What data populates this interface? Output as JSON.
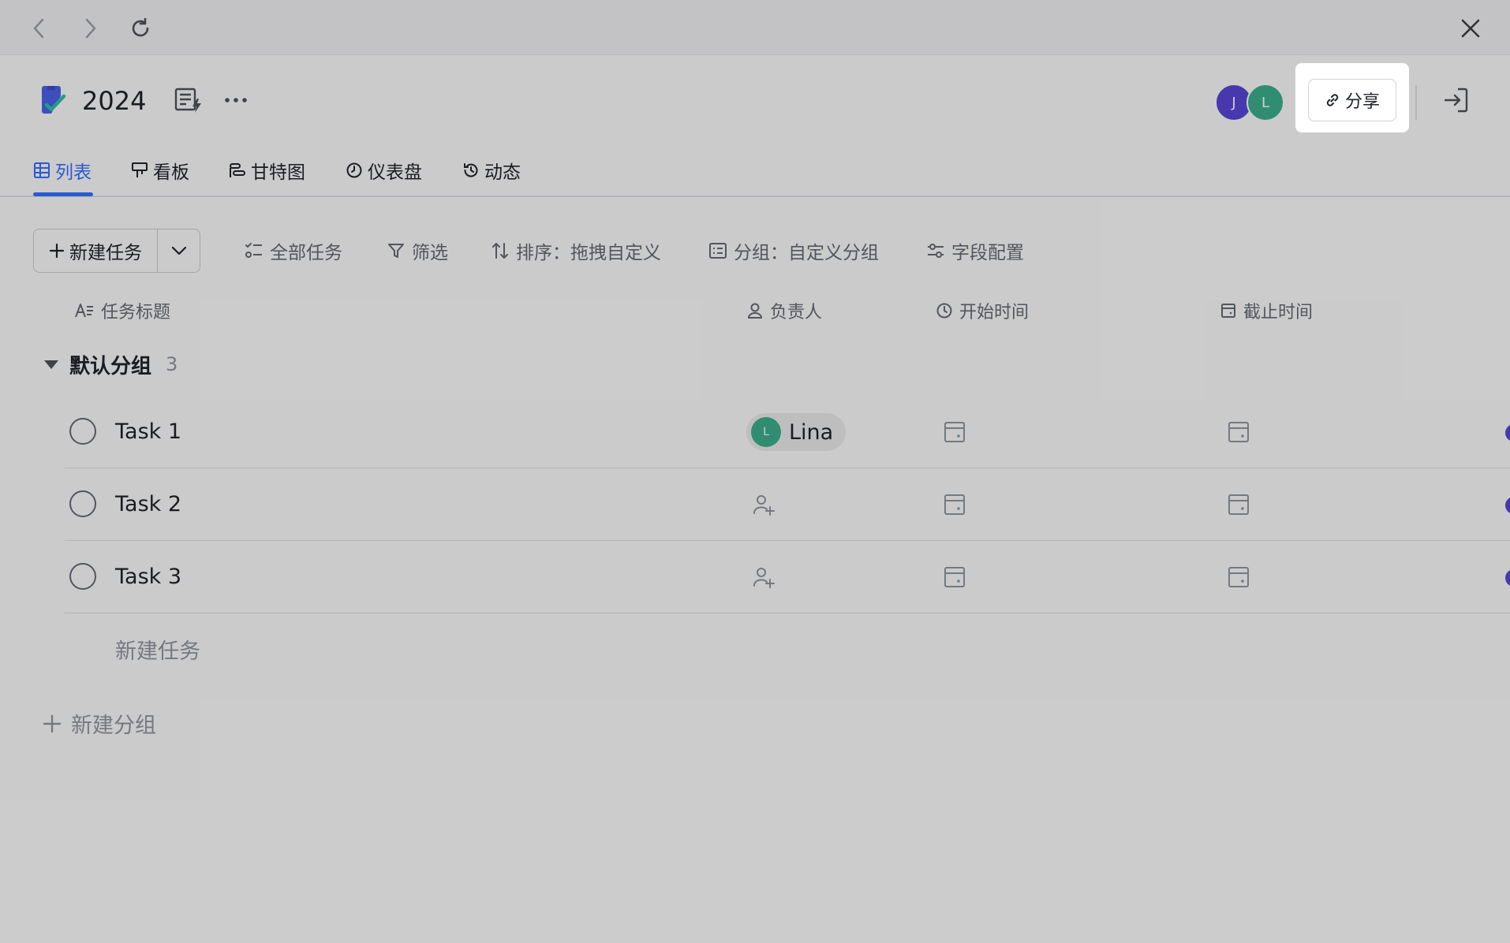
{
  "window": {
    "back_icon": "chevron-left-icon",
    "forward_icon": "chevron-right-icon",
    "reload_icon": "reload-icon",
    "close_icon": "close-icon"
  },
  "header": {
    "project_title": "2024",
    "members": [
      {
        "initial": "J",
        "color": "#5b45d6"
      },
      {
        "initial": "L",
        "color": "#3cae8c"
      }
    ],
    "share_label": "分享"
  },
  "tabs": [
    {
      "label": "列表",
      "icon": "table-icon",
      "active": true
    },
    {
      "label": "看板",
      "icon": "kanban-icon",
      "active": false
    },
    {
      "label": "甘特图",
      "icon": "gantt-icon",
      "active": false
    },
    {
      "label": "仪表盘",
      "icon": "dashboard-icon",
      "active": false
    },
    {
      "label": "动态",
      "icon": "history-icon",
      "active": false
    }
  ],
  "toolbar": {
    "new_task_label": "新建任务",
    "all_tasks_label": "全部任务",
    "filter_label": "筛选",
    "sort_label": "排序：拖拽自定义",
    "group_label": "分组：自定义分组",
    "fields_label": "字段配置"
  },
  "columns": {
    "title": "任务标题",
    "assignee": "负责人",
    "start": "开始时间",
    "due": "截止时间"
  },
  "group": {
    "name": "默认分组",
    "count": "3"
  },
  "tasks": [
    {
      "title": "Task 1",
      "assignee": "Lina",
      "assignee_initial": "L"
    },
    {
      "title": "Task 2",
      "assignee": null
    },
    {
      "title": "Task 3",
      "assignee": null
    }
  ],
  "new_task_row_label": "新建任务",
  "new_group_label": "新建分组",
  "colors": {
    "accent": "#3370ff",
    "avatar_purple": "#5b45d6",
    "avatar_green": "#3cae8c"
  }
}
